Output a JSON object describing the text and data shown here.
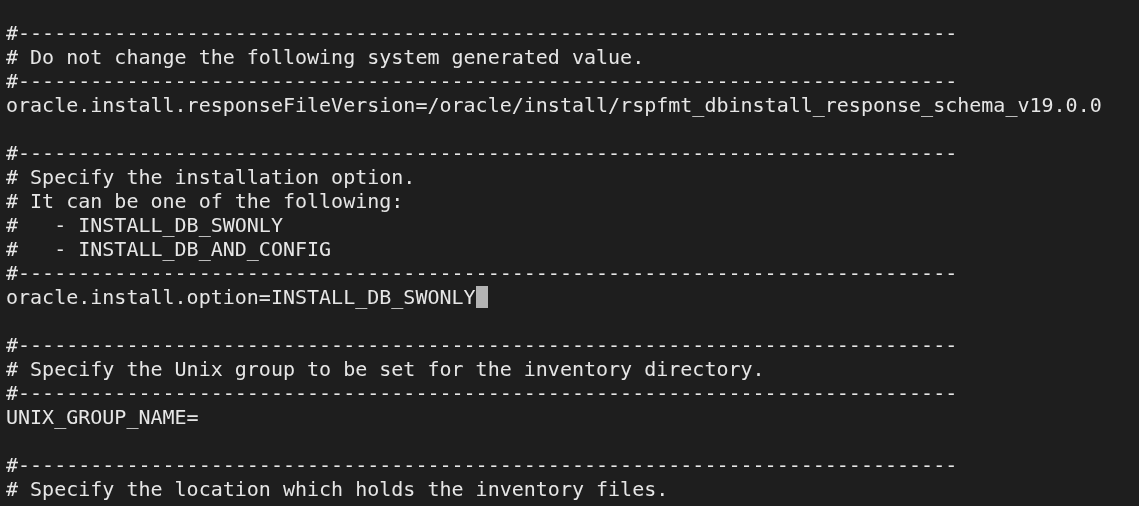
{
  "terminal": {
    "lines": [
      {
        "kind": "text",
        "text": "#------------------------------------------------------------------------------"
      },
      {
        "kind": "text",
        "text": "# Do not change the following system generated value."
      },
      {
        "kind": "text",
        "text": "#------------------------------------------------------------------------------"
      },
      {
        "kind": "text",
        "text": "oracle.install.responseFileVersion=/oracle/install/rspfmt_dbinstall_response_schema_v19.0.0"
      },
      {
        "kind": "blank"
      },
      {
        "kind": "text",
        "text": "#------------------------------------------------------------------------------"
      },
      {
        "kind": "text",
        "text": "# Specify the installation option."
      },
      {
        "kind": "text",
        "text": "# It can be one of the following:"
      },
      {
        "kind": "text",
        "text": "#   - INSTALL_DB_SWONLY"
      },
      {
        "kind": "text",
        "text": "#   - INSTALL_DB_AND_CONFIG"
      },
      {
        "kind": "text",
        "text": "#------------------------------------------------------------------------------"
      },
      {
        "kind": "text",
        "text": "oracle.install.option=INSTALL_DB_SWONLY",
        "cursor": true
      },
      {
        "kind": "blank"
      },
      {
        "kind": "text",
        "text": "#------------------------------------------------------------------------------"
      },
      {
        "kind": "text",
        "text": "# Specify the Unix group to be set for the inventory directory."
      },
      {
        "kind": "text",
        "text": "#------------------------------------------------------------------------------"
      },
      {
        "kind": "text",
        "text": "UNIX_GROUP_NAME="
      },
      {
        "kind": "blank"
      },
      {
        "kind": "text",
        "text": "#------------------------------------------------------------------------------"
      },
      {
        "kind": "text",
        "text": "# Specify the location which holds the inventory files."
      }
    ]
  }
}
